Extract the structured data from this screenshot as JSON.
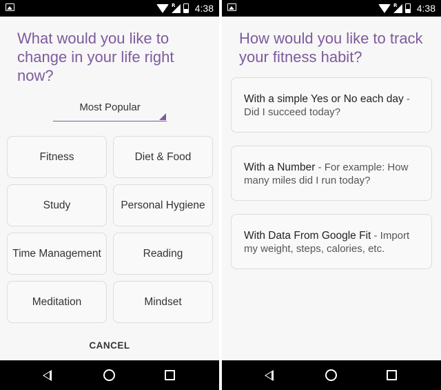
{
  "status_bar": {
    "time": "4:38",
    "icons": [
      "image-notification-icon",
      "wifi-icon",
      "signal-icon",
      "battery-icon"
    ],
    "roaming_label": "R"
  },
  "left_screen": {
    "question": "What would you like to change in your life right now?",
    "dropdown": {
      "selected": "Most Popular"
    },
    "categories": [
      {
        "label": "Fitness"
      },
      {
        "label": "Diet & Food"
      },
      {
        "label": "Study"
      },
      {
        "label": "Personal Hygiene"
      },
      {
        "label": "Time Management"
      },
      {
        "label": "Reading"
      },
      {
        "label": "Meditation"
      },
      {
        "label": "Mindset"
      }
    ],
    "cancel_label": "CANCEL"
  },
  "right_screen": {
    "question": "How would you like to track your fitness habit?",
    "options": [
      {
        "title": "With a simple Yes or No each day",
        "description": " - Did I succeed today?"
      },
      {
        "title": "With a Number",
        "description": " - For example: How many miles did I run today?"
      },
      {
        "title": "With Data From Google Fit",
        "description": " - Import my weight, steps, calories, etc."
      }
    ]
  },
  "nav_bar": {
    "icons": [
      "back-icon",
      "home-icon",
      "recent-apps-icon"
    ]
  },
  "colors": {
    "accent": "#7d5a9e",
    "background": "#f7f7f7",
    "card_border": "#dcdcdc",
    "bars": "#000000"
  }
}
